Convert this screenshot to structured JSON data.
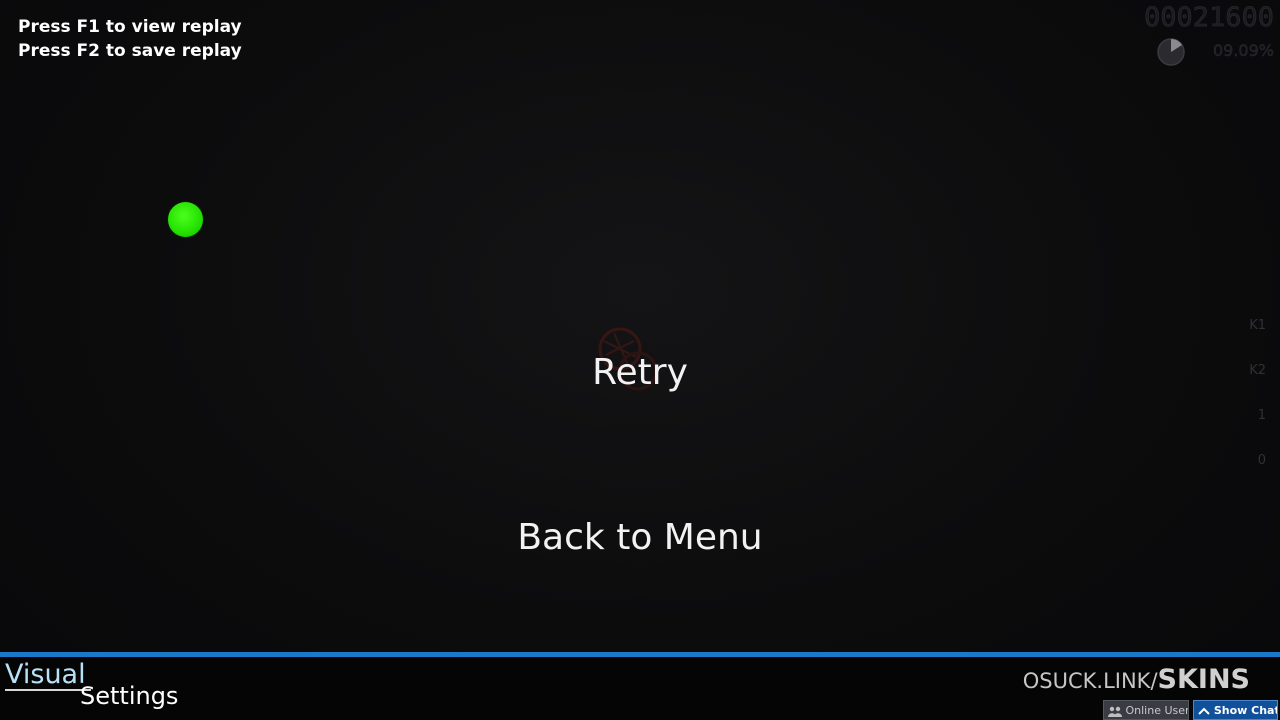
{
  "hints": {
    "line1": "Press F1 to view replay",
    "line2": "Press F2 to save replay"
  },
  "hud": {
    "score": "00021600",
    "accuracy": "09.09%",
    "progress_icon": "progress-pie-icon"
  },
  "key_overlay": {
    "k1": "K1",
    "k2": "K2",
    "m1": "1",
    "m2": "0"
  },
  "pause_menu": {
    "retry_label": "Retry",
    "back_label": "Back to Menu"
  },
  "bottom": {
    "visual_label": "Visual",
    "settings_label": "Settings",
    "skins_prefix": "OSUCK.LINK/",
    "skins_main": "SKINS",
    "online_users_label": "Online Users",
    "show_chat_label": "Show Chat"
  },
  "colors": {
    "accent_line": "#1a79c9",
    "cursor": "#23e000",
    "show_chat_bg": "#11509a"
  }
}
